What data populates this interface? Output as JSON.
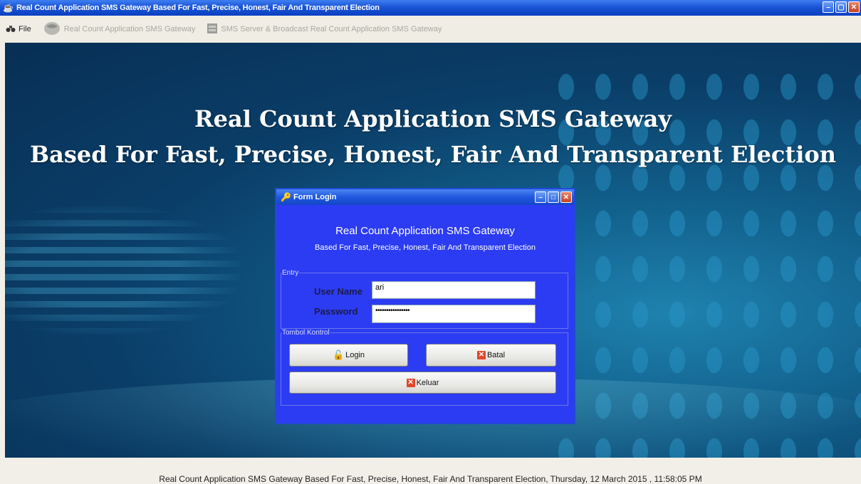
{
  "window": {
    "title": "Real Count Application SMS Gateway Based For Fast, Precise, Honest, Fair And Transparent Election"
  },
  "menubar": {
    "items": [
      {
        "label": "File",
        "icon": "binoculars-icon"
      },
      {
        "label": "Real Count Application SMS Gateway",
        "icon": "globe-icon"
      },
      {
        "label": "SMS Server & Broadcast Real Count Application SMS Gateway",
        "icon": "server-icon"
      }
    ]
  },
  "main": {
    "heading_line1": "Real Count Application SMS Gateway",
    "heading_line2": "Based For Fast, Precise, Honest, Fair And Transparent Election"
  },
  "dialog": {
    "title": "Form Login",
    "heading": "Real Count Application SMS Gateway",
    "subheading": "Based For Fast, Precise, Honest, Fair And Transparent Election",
    "entry_legend": "Entry",
    "username_label": "User Name",
    "username_value": "ari",
    "password_label": "Password",
    "password_value": "••••••••••••••••",
    "control_legend": "Tombol Kontrol",
    "login_label": "Login",
    "cancel_label": "Batal",
    "exit_label": "Keluar"
  },
  "status": {
    "text": "Real Count Application SMS Gateway Based For Fast, Precise, Honest, Fair And Transparent Election, Thursday, 12 March 2015 , 11:58:05 PM"
  },
  "colors": {
    "title_blue": "#1a55d6",
    "dialog_blue": "#2c3cf2",
    "close_red": "#c8401e"
  }
}
